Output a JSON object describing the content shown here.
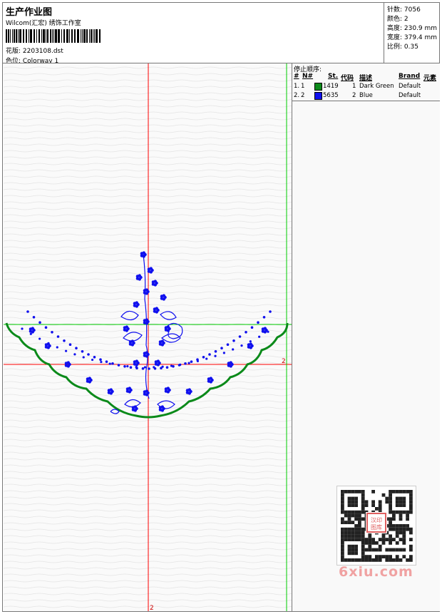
{
  "header": {
    "title": "生产作业图",
    "company": "Wilcom(汇宏) 绣饰工作室",
    "file_label": "花版: 2203108.dst",
    "colorway_label": "色位: Colorway 1"
  },
  "stats": [
    {
      "label": "针数: 7056"
    },
    {
      "label": "颜色: 2"
    },
    {
      "label": "高度: 230.9 mm"
    },
    {
      "label": "宽度: 379.4 mm"
    },
    {
      "label": "比例: 0.35"
    }
  ],
  "stop_sequence": {
    "title": "停止顺序:",
    "columns": [
      "#",
      "N#",
      "St.",
      "代码",
      "描述",
      "Brand",
      "元素"
    ],
    "rows": [
      {
        "idx": "1.",
        "n": "1",
        "st": "1419",
        "code": "1",
        "desc": "Dark Green",
        "brand": "Default",
        "color": "#0b8a1a"
      },
      {
        "idx": "2.",
        "n": "2",
        "st": "5635",
        "code": "2",
        "desc": "Blue",
        "brand": "Default",
        "color": "#1010ee"
      }
    ]
  },
  "axes": {
    "v_marker": "2",
    "h_marker": "2"
  },
  "watermark": {
    "text": "6xiu.com",
    "seal": "汉印图库"
  },
  "colors": {
    "thread_green": "#0b8a1a",
    "thread_blue": "#1010ee",
    "guide_red": "#ff0000",
    "guide_green": "#00cc00"
  }
}
